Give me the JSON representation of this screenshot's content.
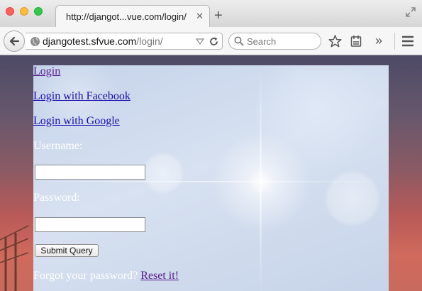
{
  "browser": {
    "tab_title": "http://djangot...vue.com/login/",
    "tab_close": "✕",
    "new_tab": "+",
    "url_host": "djangotest.sfvue.com",
    "url_path": "/login/",
    "search_placeholder": "Search",
    "more_tools": "»"
  },
  "page": {
    "links": {
      "login": "Login",
      "facebook": "Login with Facebook",
      "google": "Login with Google"
    },
    "username_label": "Username:",
    "username_value": "",
    "password_label": "Password:",
    "password_value": "",
    "submit_label": "Submit Query",
    "forgot_text": "Forgot your password?",
    "reset_link": "Reset it!"
  },
  "colors": {
    "link": "#1a0dab",
    "visited_link": "#551a8b",
    "label_text": "#ffffff"
  }
}
